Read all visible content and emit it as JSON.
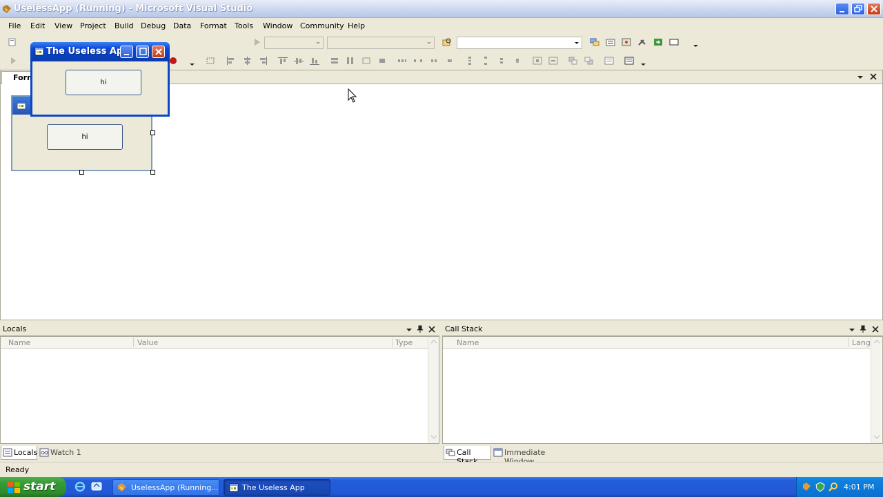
{
  "window": {
    "title": "UselessApp (Running) - Microsoft Visual Studio"
  },
  "menu": [
    "File",
    "Edit",
    "View",
    "Project",
    "Build",
    "Debug",
    "Data",
    "Format",
    "Tools",
    "Window",
    "Community",
    "Help"
  ],
  "document_tab": {
    "label": "Form"
  },
  "designer": {
    "button_label": "hi"
  },
  "running_app": {
    "title": "The Useless App",
    "button_label": "hi"
  },
  "locals_panel": {
    "title": "Locals",
    "columns": [
      "Name",
      "Value",
      "Type"
    ]
  },
  "callstack_panel": {
    "title": "Call Stack",
    "columns": [
      "Name",
      "Lang"
    ]
  },
  "left_tabs": [
    "Locals",
    "Watch 1"
  ],
  "right_tabs": [
    "Call Stack",
    "Immediate Window"
  ],
  "status": {
    "text": "Ready"
  },
  "taskbar": {
    "start_label": "start",
    "items": [
      "UselessApp (Running...",
      "The Useless App"
    ],
    "clock": "4:01 PM"
  },
  "colors": {
    "xp_blue": "#0a46c8",
    "start_green": "#379c35",
    "face": "#ece9d8"
  }
}
